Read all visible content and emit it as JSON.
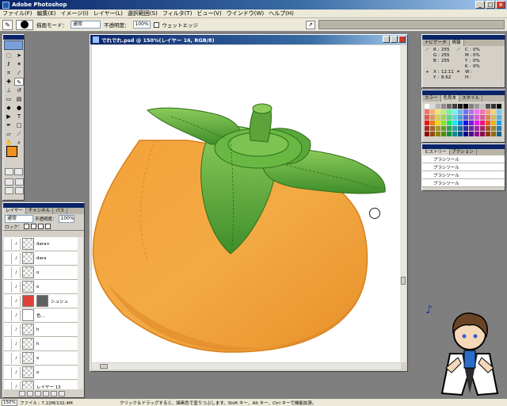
{
  "app": {
    "title": "Adobe Photoshop",
    "window_buttons": [
      "_",
      "□",
      "×"
    ]
  },
  "menu": [
    "ファイル(F)",
    "編集(E)",
    "イメージ(I)",
    "レイヤー(L)",
    "選択範囲(S)",
    "フィルタ(T)",
    "ビュー(V)",
    "ウインドウ(W)",
    "ヘルプ(H)"
  ],
  "options": {
    "mode_label": "描画モード：",
    "mode_value": "通常",
    "opacity_label": "不透明度：",
    "opacity_value": "100%",
    "wet_edges_label": "ウェットエッジ"
  },
  "document": {
    "title": "でれでれ.psd @ 150%(レイヤー 16, RGB/8)"
  },
  "info_panel": {
    "tabs": [
      "ナビゲータ",
      "情報"
    ],
    "rows": [
      [
        "R :",
        "255",
        "C :",
        "0%"
      ],
      [
        "G :",
        "255",
        "M :",
        "0%"
      ],
      [
        "B :",
        "255",
        "Y :",
        "0%"
      ],
      [
        "",
        "",
        "K :",
        "0%"
      ],
      [
        "X :",
        "12.11",
        "W :",
        ""
      ],
      [
        "Y :",
        "8.62",
        "H :",
        ""
      ]
    ]
  },
  "color_panel": {
    "tabs": [
      "カラー",
      "色見本",
      "スタイル"
    ]
  },
  "history_panel": {
    "tabs": [
      "ヒストリー",
      "アクション"
    ],
    "items": [
      "ブラシツール",
      "ブラシツール",
      "ブラシツール",
      "ブラシツール"
    ]
  },
  "layers_panel": {
    "tabs": [
      "レイヤー",
      "チャンネル",
      "パス"
    ],
    "blend_mode": "通常",
    "opacity_label": "不透明度：",
    "opacity_value": "100%",
    "lock_label": "ロック：",
    "layers": [
      {
        "name": "dara+",
        "thumb": "trans"
      },
      {
        "name": "dara",
        "thumb": "trans"
      },
      {
        "name": "o",
        "thumb": "trans"
      },
      {
        "name": "o",
        "thumb": "trans"
      },
      {
        "name": "シュシュ",
        "thumb": "red"
      },
      {
        "name": "色...",
        "thumb": "white"
      },
      {
        "name": "h",
        "thumb": "trans"
      },
      {
        "name": "h",
        "thumb": "trans"
      },
      {
        "name": "o",
        "thumb": "trans"
      },
      {
        "name": "o",
        "thumb": "trans"
      },
      {
        "name": "レイヤー 13",
        "thumb": "trans"
      }
    ]
  },
  "status": {
    "zoom": "150%",
    "file_info": "ファイル : 7.22M/132.4M",
    "hint": "クリック＆ドラッグすると、描画色で塗りつぶします。Shift キー、Alt キー、Ctrl キーで機能拡張。"
  },
  "colors": {
    "persimmon": "#f0a030",
    "leaf": "#5aa83a",
    "foreground": "#f09020"
  }
}
